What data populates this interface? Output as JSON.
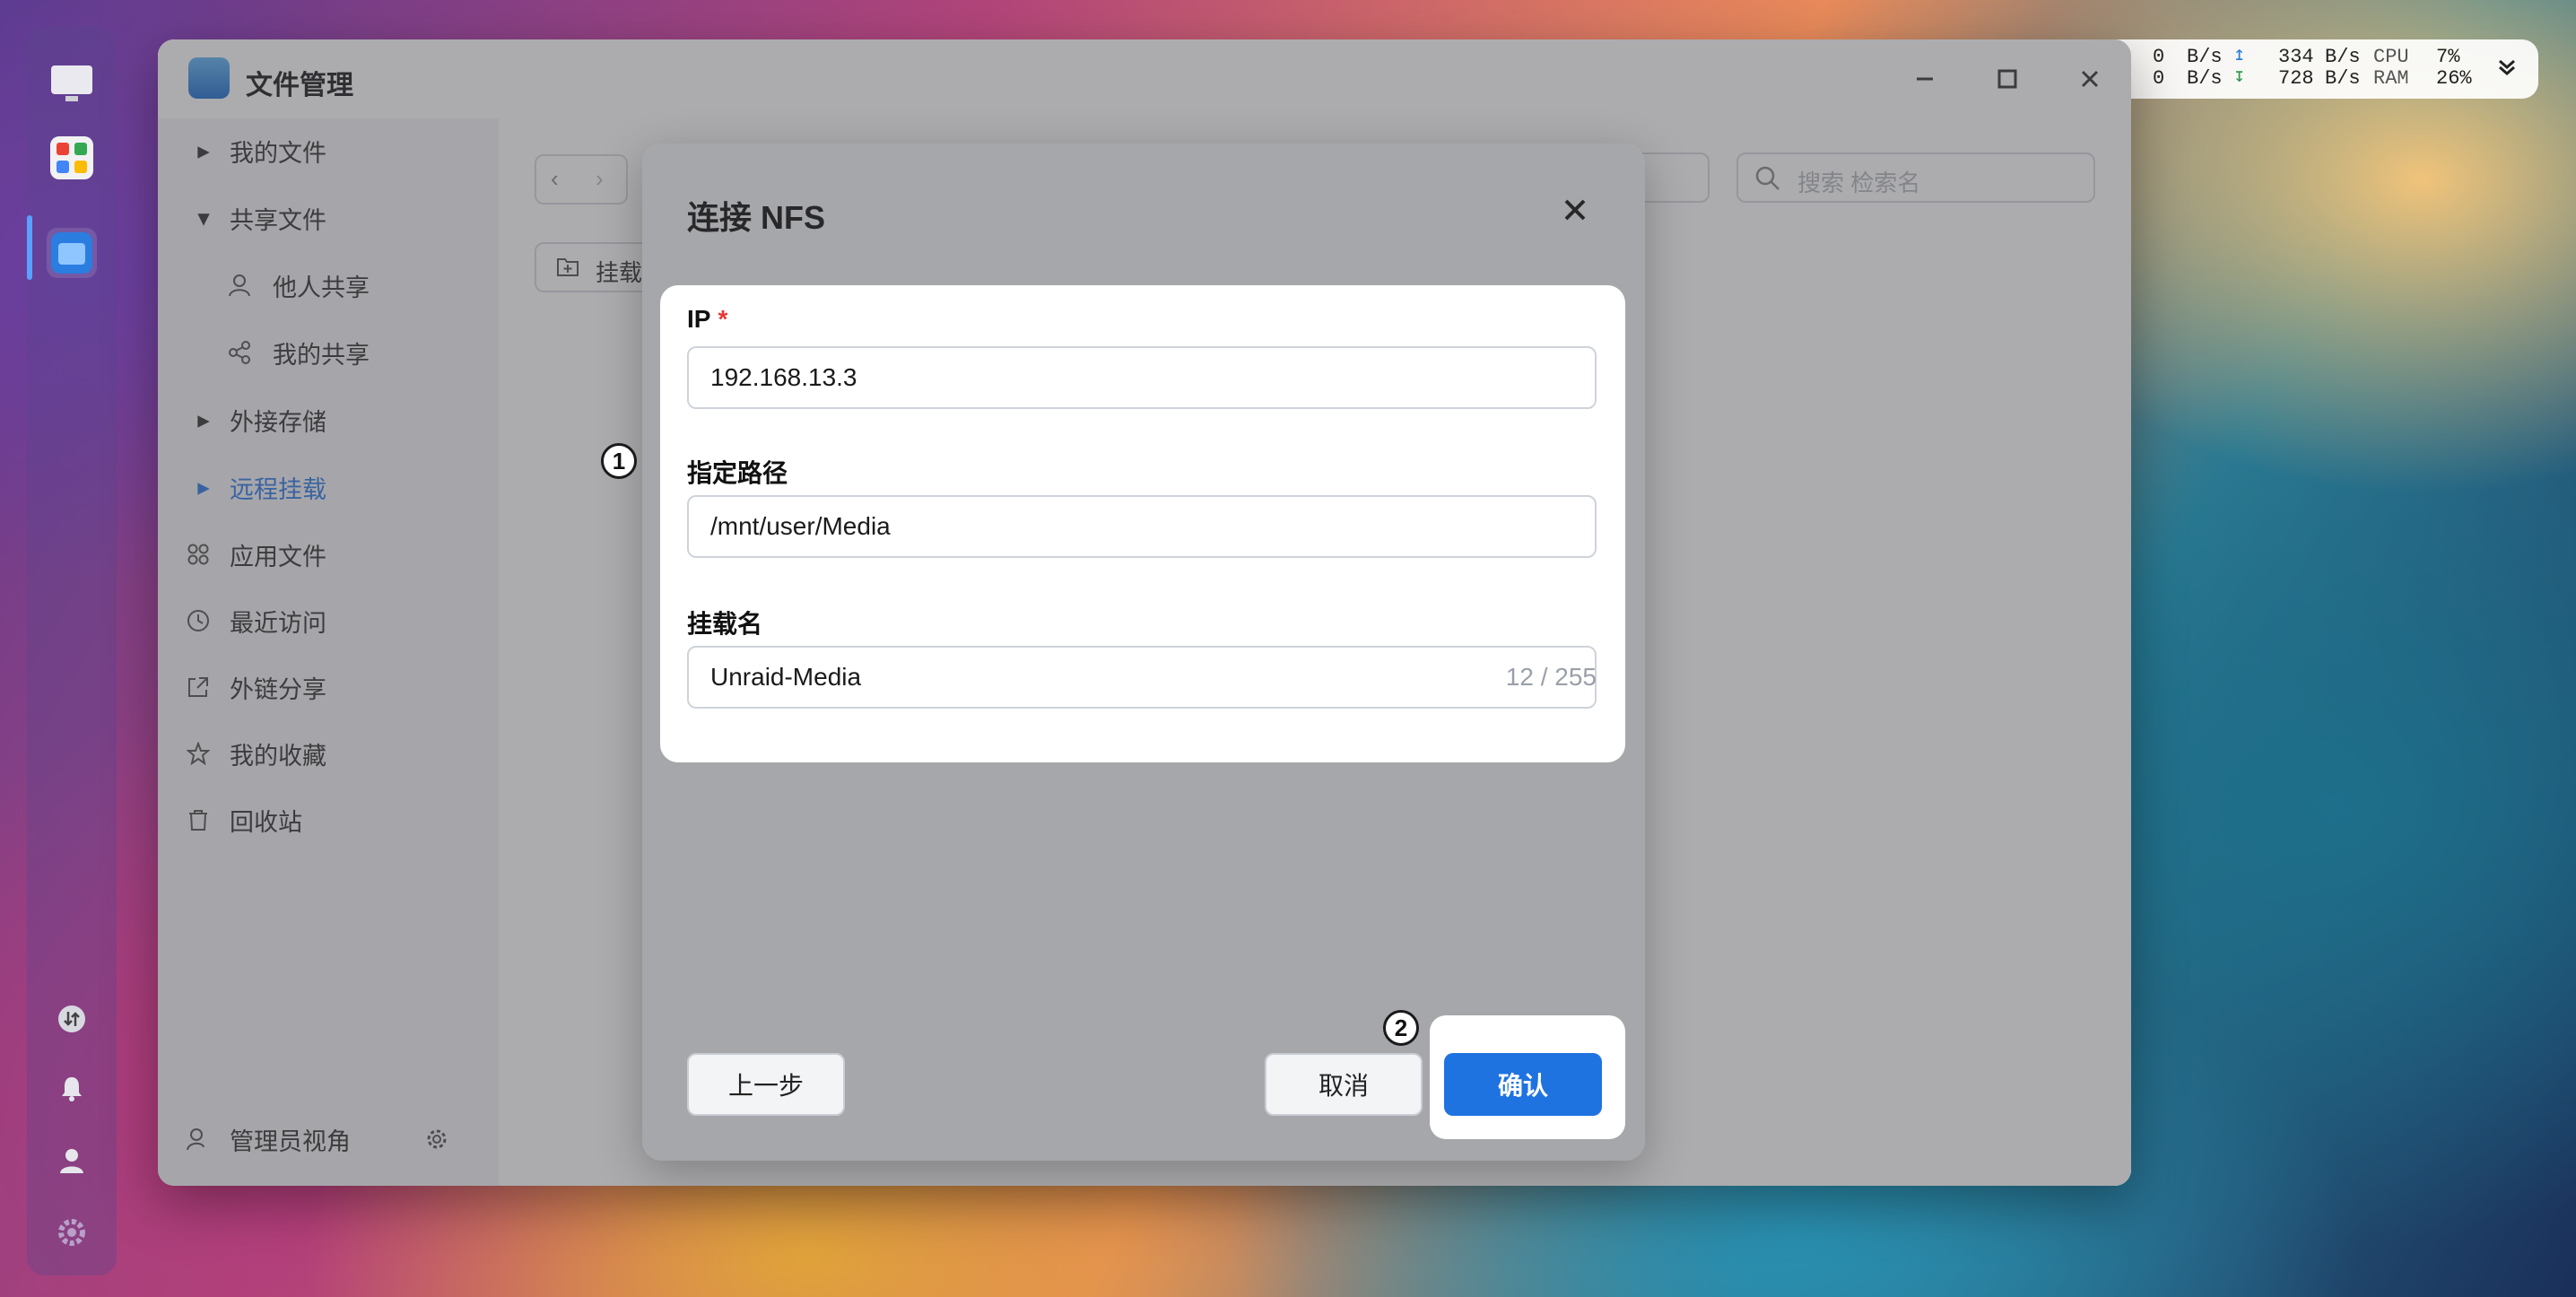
{
  "window": {
    "title": "文件管理"
  },
  "sysmon": {
    "up_rate": "0",
    "up_unit": "B/s",
    "down_rate": "0",
    "down_unit": "B/s",
    "tx_rate": "334",
    "tx_unit": "B/s",
    "rx_rate": "728",
    "rx_unit": "B/s",
    "cpu_label": "CPU",
    "cpu_value": "7%",
    "ram_label": "RAM",
    "ram_value": "26%"
  },
  "sidebar": {
    "items": [
      {
        "label": "我的文件"
      },
      {
        "label": "共享文件"
      },
      {
        "label": "他人共享"
      },
      {
        "label": "我的共享"
      },
      {
        "label": "外接存储"
      },
      {
        "label": "远程挂载"
      },
      {
        "label": "应用文件"
      },
      {
        "label": "最近访问"
      },
      {
        "label": "外链分享"
      },
      {
        "label": "我的收藏"
      },
      {
        "label": "回收站"
      }
    ],
    "footer": {
      "label": "管理员视角"
    }
  },
  "main": {
    "mount_button": "挂载远",
    "search_placeholder": "搜索 检索名"
  },
  "dialog": {
    "title": "连接 NFS",
    "fields": {
      "ip": {
        "label": "IP",
        "required_mark": "*",
        "value": "192.168.13.3"
      },
      "path": {
        "label": "指定路径",
        "value": "/mnt/user/Media"
      },
      "mount_name": {
        "label": "挂载名",
        "value": "Unraid-Media",
        "counter": "12 / 255"
      }
    },
    "buttons": {
      "back": "上一步",
      "cancel": "取消",
      "confirm": "确认"
    }
  },
  "annotations": {
    "badge1": "1",
    "badge2": "2"
  },
  "colors": {
    "accent": "#1f73e0",
    "required": "#e53935",
    "app_icon": "#1e6fd0"
  }
}
